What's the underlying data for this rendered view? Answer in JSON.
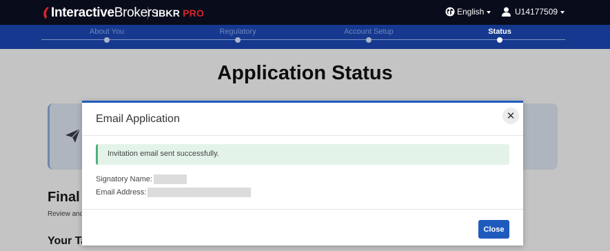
{
  "header": {
    "brand_bold": "Interactive",
    "brand_regular": "Brokers",
    "product_prefix": "IBKR",
    "product_suffix": "PRO",
    "language": "English",
    "username": "U14177509"
  },
  "steps": [
    {
      "label": "About You"
    },
    {
      "label": "Regulatory"
    },
    {
      "label": "Account Setup"
    },
    {
      "label": "Status"
    }
  ],
  "page": {
    "title": "Application Status",
    "section_heading": "Final",
    "section_sub": "Review and",
    "section_heading2": "Your Ta"
  },
  "modal": {
    "title": "Email Application",
    "close_glyph": "✕",
    "alert": "Invitation email sent successfully.",
    "signatory_label": "Signatory Name:",
    "email_label": "Email Address:",
    "close_button": "Close"
  },
  "colors": {
    "topbar": "#090c1a",
    "stepbar": "#16398f",
    "accent": "#1f5bbd",
    "brand_red": "#d8242a",
    "alert_bg": "#e4f3ea"
  }
}
